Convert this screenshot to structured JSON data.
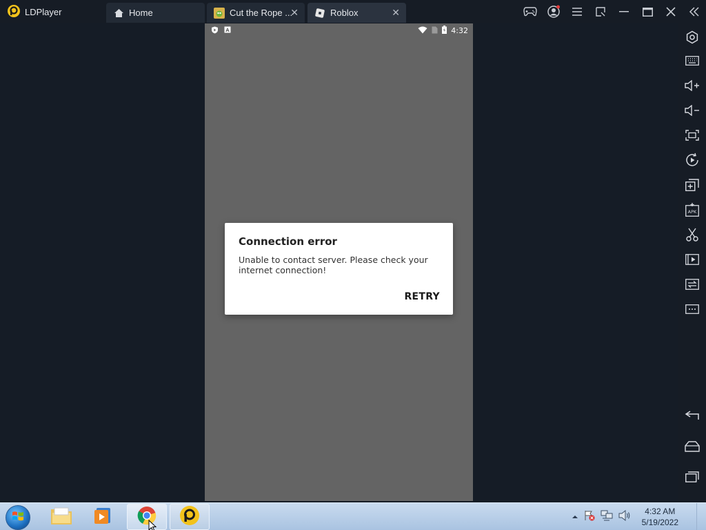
{
  "app": {
    "name": "LDPlayer"
  },
  "tabs": [
    {
      "label": "Home"
    },
    {
      "label": "Cut the Rope ..."
    },
    {
      "label": "Roblox"
    }
  ],
  "android": {
    "status_time": "4:32"
  },
  "dialog": {
    "title": "Connection error",
    "message": "Unable to contact server. Please check your internet connection!",
    "button": "RETRY"
  },
  "taskbar": {
    "time": "4:32 AM",
    "date": "5/19/2022"
  },
  "colors": {
    "background": "#151c26",
    "screen": "#646464",
    "dialog": "#ffffff",
    "taskbar": "#b9cfe8"
  }
}
